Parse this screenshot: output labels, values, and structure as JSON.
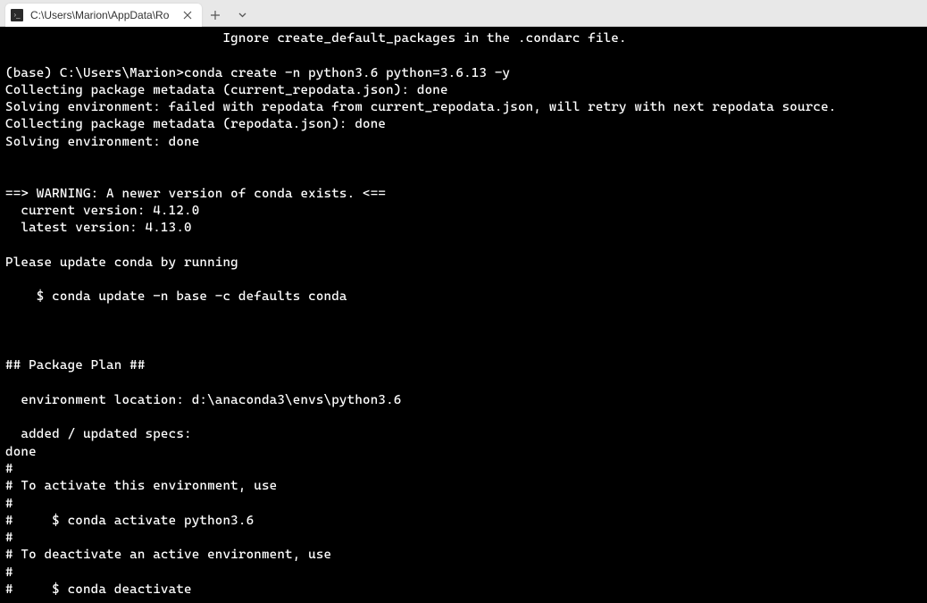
{
  "tab": {
    "title": "C:\\Users\\Marion\\AppData\\Ro"
  },
  "terminal": {
    "lines": [
      "                            Ignore create_default_packages in the .condarc file.",
      "",
      "(base) C:\\Users\\Marion>conda create -n python3.6 python=3.6.13 -y",
      "Collecting package metadata (current_repodata.json): done",
      "Solving environment: failed with repodata from current_repodata.json, will retry with next repodata source.",
      "Collecting package metadata (repodata.json): done",
      "Solving environment: done",
      "",
      "",
      "==> WARNING: A newer version of conda exists. <==",
      "  current version: 4.12.0",
      "  latest version: 4.13.0",
      "",
      "Please update conda by running",
      "",
      "    $ conda update -n base -c defaults conda",
      "",
      "",
      "",
      "## Package Plan ##",
      "",
      "  environment location: d:\\anaconda3\\envs\\python3.6",
      "",
      "  added / updated specs:",
      "done",
      "#",
      "# To activate this environment, use",
      "#",
      "#     $ conda activate python3.6",
      "#",
      "# To deactivate an active environment, use",
      "#",
      "#     $ conda deactivate"
    ]
  }
}
